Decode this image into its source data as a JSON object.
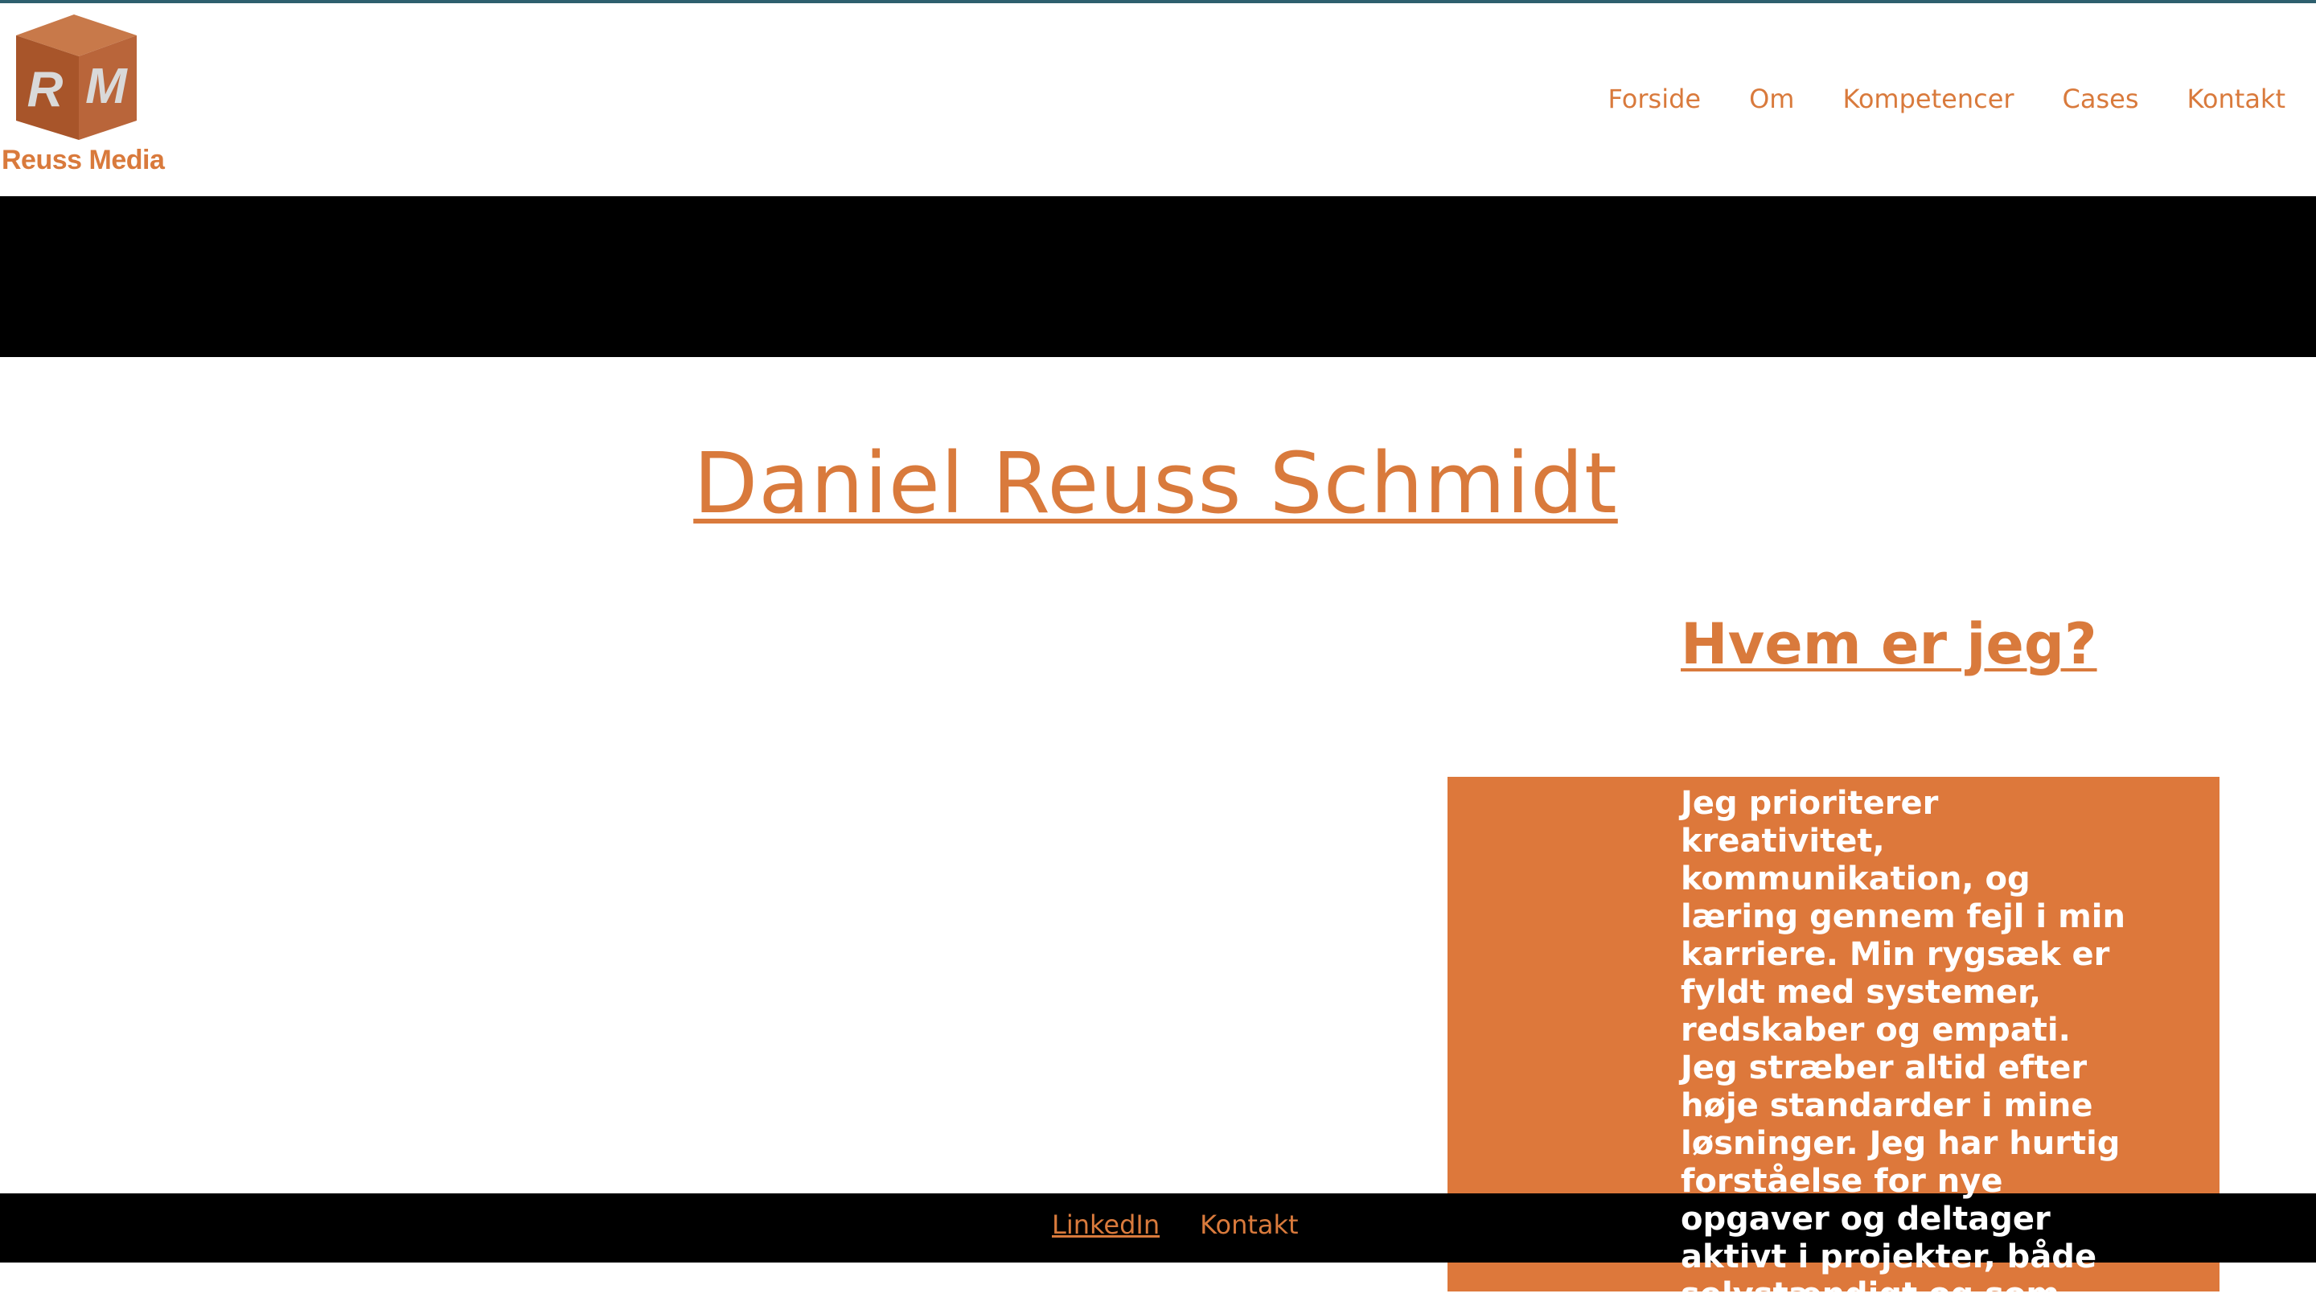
{
  "brand": {
    "logo_letters": "R M",
    "name": "Reuss Media"
  },
  "nav": {
    "items": [
      "Forside",
      "Om",
      "Kompetencer",
      "Cases",
      "Kontakt"
    ]
  },
  "main": {
    "title": "Daniel Reuss Schmidt",
    "about_heading": "Hvem er jeg?",
    "about_text": "Jeg prioriterer kreativitet, kommunikation, og læring gennem fejl i min karriere. Min rygsæk er fyldt med systemer, redskaber og empati. Jeg stræber altid efter høje standarder i mine løsninger. Jeg har hurtig forståelse for nye opgaver og deltager aktivt i projekter, både selvstændigt og som"
  },
  "footer": {
    "linkedin": "LinkedIn",
    "kontakt": "Kontakt"
  },
  "colors": {
    "accent": "#d97a3c",
    "about_box": "#dd783b",
    "banner": "#000000",
    "top_rule": "#2e5f6e"
  }
}
